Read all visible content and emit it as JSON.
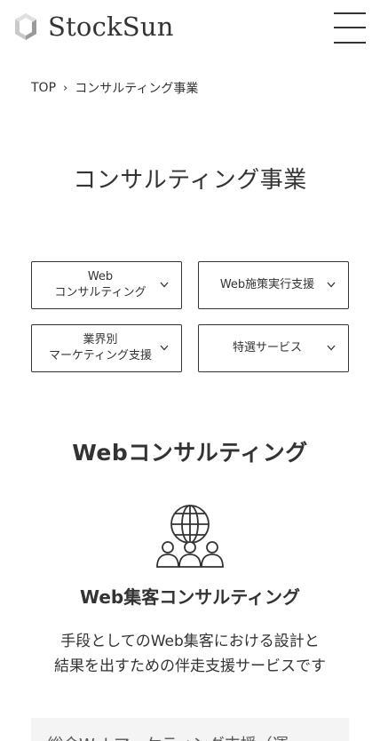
{
  "header": {
    "logo_text": "StockSun",
    "logo_icon": "hexagon-logo-icon",
    "menu_icon": "hamburger-menu-icon"
  },
  "breadcrumb": {
    "home": "TOP",
    "separator": "›",
    "current": "コンサルティング事業"
  },
  "page_title": "コンサルティング事業",
  "categories": [
    {
      "line1": "Web",
      "line2": "コンサルティング"
    },
    {
      "line1": "Web施策実行支援",
      "line2": ""
    },
    {
      "line1": "業界別",
      "line2": "マーケティング支援"
    },
    {
      "line1": "特選サービス",
      "line2": ""
    }
  ],
  "section": {
    "title": "Webコンサルティング",
    "service": {
      "icon": "globe-people-icon",
      "title": "Web集客コンサルティング",
      "desc_line1": "手段としてのWeb集客における設計と",
      "desc_line2": "結果を出すための伴走支援サービスです"
    },
    "next_card_text": "総合Webマーケティング支援（運"
  },
  "colors": {
    "text": "#333333",
    "border": "#333333",
    "card_bg": "#f4f4f4",
    "background": "#ffffff"
  }
}
